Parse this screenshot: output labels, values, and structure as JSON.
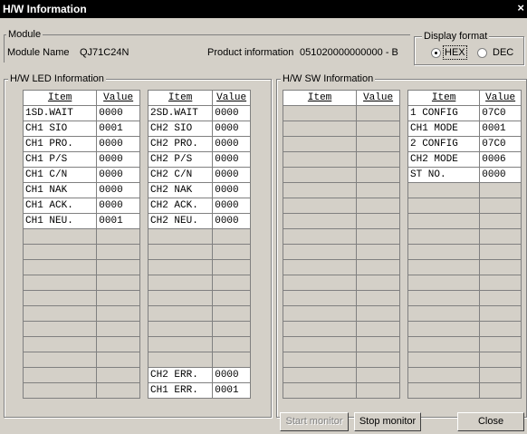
{
  "window": {
    "title": "H/W Information",
    "close_glyph": "×"
  },
  "module": {
    "group_label": "Module",
    "name_label": "Module Name",
    "name_value": "QJ71C24N",
    "product_info_label": "Product information",
    "product_info_value": "051020000000000 - B"
  },
  "display_format": {
    "group_label": "Display format",
    "options": [
      "HEX",
      "DEC"
    ],
    "selected": "HEX"
  },
  "led": {
    "group_label": "H/W LED Information",
    "headers": [
      "Item",
      "Value"
    ],
    "table1": [
      [
        "1SD.WAIT",
        "0000"
      ],
      [
        "CH1 SIO",
        "0001"
      ],
      [
        "CH1 PRO.",
        "0000"
      ],
      [
        "CH1 P/S",
        "0000"
      ],
      [
        "CH1 C/N",
        "0000"
      ],
      [
        "CH1 NAK",
        "0000"
      ],
      [
        "CH1 ACK.",
        "0000"
      ],
      [
        "CH1 NEU.",
        "0001"
      ]
    ],
    "table2": [
      [
        "2SD.WAIT",
        "0000"
      ],
      [
        "CH2 SIO",
        "0000"
      ],
      [
        "CH2 PRO.",
        "0000"
      ],
      [
        "CH2 P/S",
        "0000"
      ],
      [
        "CH2 C/N",
        "0000"
      ],
      [
        "CH2 NAK",
        "0000"
      ],
      [
        "CH2 ACK.",
        "0000"
      ],
      [
        "CH2 NEU.",
        "0000"
      ]
    ],
    "table2_footer": [
      [
        "CH2 ERR.",
        "0000"
      ],
      [
        "CH1 ERR.",
        "0001"
      ]
    ]
  },
  "sw": {
    "group_label": "H/W SW Information",
    "headers": [
      "Item",
      "Value"
    ],
    "table2": [
      [
        "1 CONFIG",
        "07C0"
      ],
      [
        "CH1 MODE",
        "0001"
      ],
      [
        "2 CONFIG",
        "07C0"
      ],
      [
        "CH2 MODE",
        "0006"
      ],
      [
        "ST NO.",
        "0000"
      ]
    ]
  },
  "buttons": {
    "start": "Start monitor",
    "stop": "Stop monitor",
    "close": "Close"
  }
}
